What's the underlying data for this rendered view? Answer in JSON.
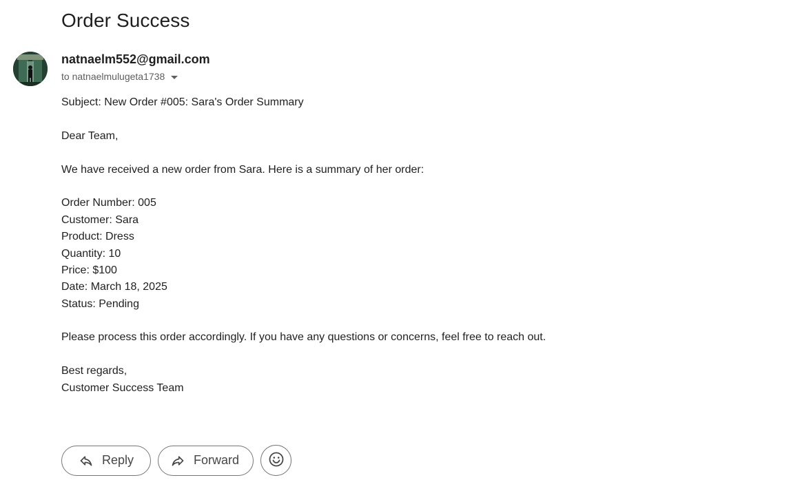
{
  "email": {
    "title": "Order Success",
    "sender": "natnaelm552@gmail.com",
    "recipient": "to natnaelmulugeta1738",
    "avatar_icon": "profile-photo-avatar",
    "body": {
      "subject_line": "Subject: New Order #005: Sara's Order Summary",
      "greeting": "Dear Team,",
      "intro": "We have received a new order from Sara. Here is a summary of her order:",
      "order_number": "Order Number: 005",
      "customer": "Customer: Sara",
      "product": "Product: Dress",
      "quantity": "Quantity: 10",
      "price": "Price: $100",
      "date": "Date: March 18, 2025",
      "status": "Status: Pending",
      "closing": "Please process this order accordingly. If you have any questions or concerns, feel free to reach out.",
      "signoff": "Best regards,",
      "signature": "Customer Success Team"
    }
  },
  "actions": {
    "reply_label": "Reply",
    "reply_icon": "reply-arrow-icon",
    "forward_label": "Forward",
    "forward_icon": "forward-arrow-icon",
    "emoji_icon": "emoji-reaction-icon"
  },
  "colors": {
    "text": "#1f1f1f",
    "muted": "#5e5e5e",
    "button_border": "#747775",
    "button_text": "#444746"
  }
}
